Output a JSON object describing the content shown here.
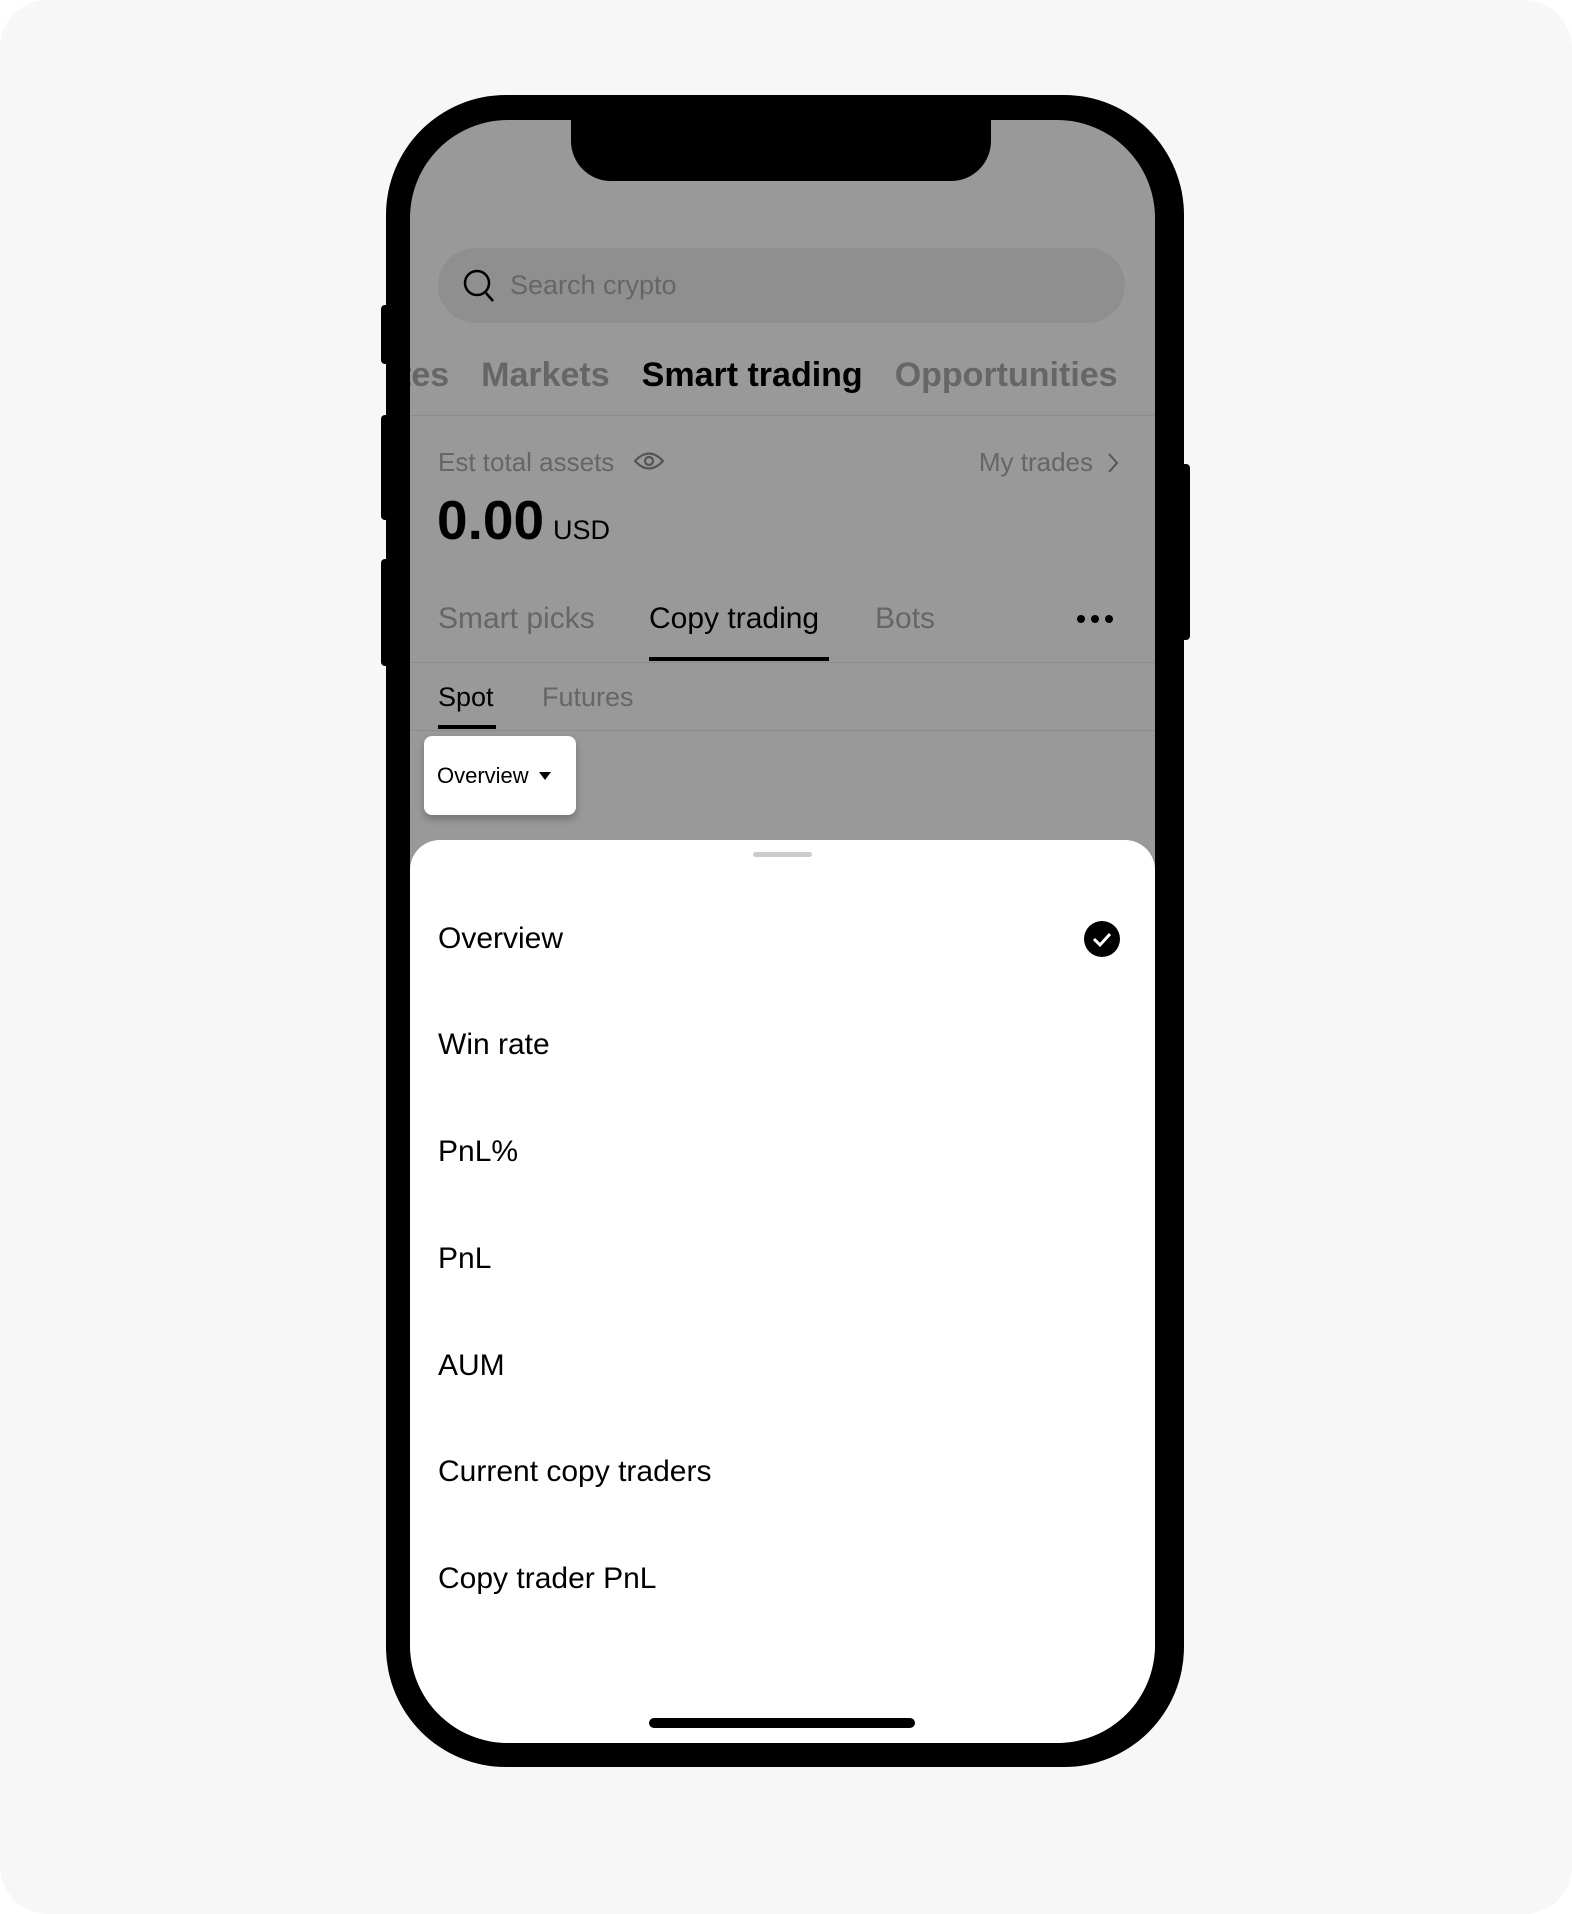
{
  "search": {
    "placeholder": "Search crypto",
    "icon": "search-icon"
  },
  "top_tabs": [
    {
      "label": "tes",
      "active": false
    },
    {
      "label": "Markets",
      "active": false
    },
    {
      "label": "Smart trading",
      "active": true
    },
    {
      "label": "Opportunities",
      "active": false
    }
  ],
  "assets": {
    "label": "Est total assets",
    "value": "0.00",
    "currency": "USD",
    "my_trades": "My trades"
  },
  "sub_tabs": [
    {
      "label": "Smart picks"
    },
    {
      "label": "Copy trading",
      "active": true
    },
    {
      "label": "Bots"
    }
  ],
  "mode_tabs": [
    {
      "label": "Spot",
      "active": true
    },
    {
      "label": "Futures"
    }
  ],
  "sort_button": {
    "label": "Overview"
  },
  "sheet": {
    "items": [
      {
        "label": "Overview",
        "selected": true
      },
      {
        "label": "Win rate"
      },
      {
        "label": "PnL%"
      },
      {
        "label": "PnL"
      },
      {
        "label": "AUM"
      },
      {
        "label": "Current copy traders"
      },
      {
        "label": "Copy trader PnL"
      }
    ]
  }
}
